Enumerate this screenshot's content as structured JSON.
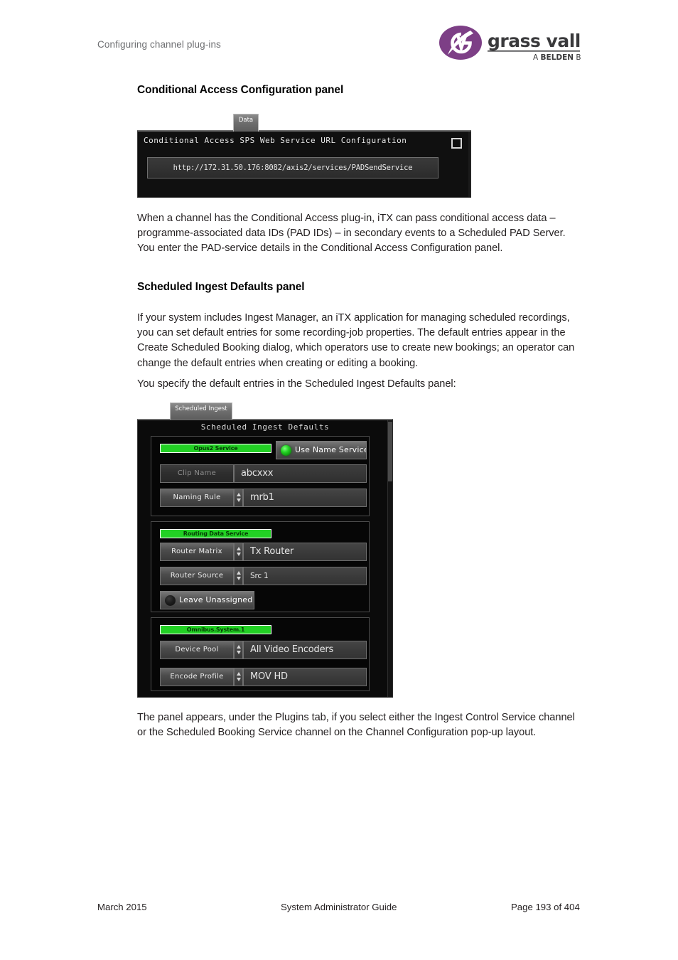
{
  "header": {
    "running_head": "Configuring channel plug-ins",
    "logo": {
      "wordmark": "grass valley",
      "tagline_prefix": "A ",
      "tagline_brand": "BELDEN",
      "tagline_suffix": " BRAND",
      "monogram": "GV",
      "color": "#7d3f86"
    }
  },
  "sections": [
    {
      "title": "Conditional Access Configuration panel",
      "paragraphs": [
        "When a channel has the Conditional Access plug-in, iTX can pass conditional access data – programme-associated data IDs (PAD IDs) – in secondary events to a Scheduled PAD Server. You enter the PAD-service details in the Conditional Access Configuration panel."
      ]
    },
    {
      "title": "Scheduled Ingest Defaults panel",
      "paragraphs": [
        "If your system includes Ingest Manager, an iTX application for managing scheduled recordings, you can set default entries for some recording-job properties. The default entries appear in the Create Scheduled Booking dialog, which operators use to create new bookings; an operator can change the default entries when creating or editing a booking.",
        "You specify the default entries in the Scheduled Ingest Defaults panel:",
        "The panel appears, under the Plugins tab, if you select either the Ingest Control Service channel or the Scheduled Booking Service channel on the Channel Configuration pop-up layout."
      ]
    }
  ],
  "figure_conditional_access": {
    "tab_label": "Data",
    "panel_title": "Conditional Access SPS Web Service URL Configuration",
    "checkbox_checked": false,
    "url_value": "http://172.31.50.176:8082/axis2/services/PADSendService"
  },
  "figure_scheduled_ingest": {
    "tab_label": "Scheduled Ingest",
    "panel_title": "Scheduled Ingest Defaults",
    "groups": [
      {
        "service_badge": "Opus2 Service",
        "toggle": {
          "label": "Use Name Service",
          "led_on": true
        },
        "rows": [
          {
            "label": "Clip Name",
            "value": "abcxxx",
            "spinner": false,
            "label_dim": true,
            "value_size": "large"
          },
          {
            "label": "Naming Rule",
            "value": "mrb1",
            "spinner": true,
            "label_dim": false,
            "value_size": "large"
          }
        ]
      },
      {
        "service_badge": "Routing Data Service",
        "toggle": {
          "label": "Leave Unassigned",
          "led_on": false
        },
        "rows": [
          {
            "label": "Router Matrix",
            "value": "Tx Router",
            "spinner": true,
            "label_dim": false,
            "value_size": "large"
          },
          {
            "label": "Router Source",
            "value": "Src 1",
            "spinner": true,
            "label_dim": false,
            "value_size": "small"
          }
        ]
      },
      {
        "service_badge": "Omnibus.System.1",
        "rows": [
          {
            "label": "Device Pool",
            "value": "All Video Encoders",
            "spinner": true,
            "label_dim": false,
            "value_size": "large"
          },
          {
            "label": "Encode Profile",
            "value": "MOV HD",
            "spinner": true,
            "label_dim": false,
            "value_size": "large"
          }
        ]
      }
    ]
  },
  "footer": {
    "date": "March 2015",
    "title": "System Administrator Guide",
    "page": "Page 193 of 404"
  }
}
